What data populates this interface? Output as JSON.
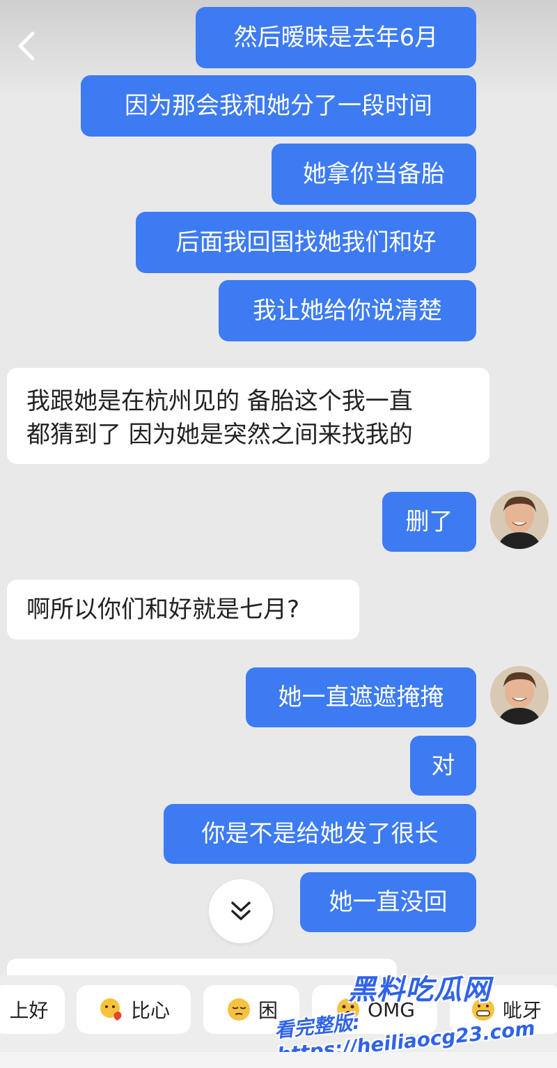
{
  "header": {
    "back_icon": "chevron-left-icon"
  },
  "messages": [
    {
      "side": "out",
      "text": "然后暧昧是去年6月"
    },
    {
      "side": "out",
      "text": "因为那会我和她分了一段时间"
    },
    {
      "side": "out",
      "text": "她拿你当备胎"
    },
    {
      "side": "out",
      "text": "后面我回国找她我们和好"
    },
    {
      "side": "out",
      "text": "我让她给你说清楚"
    },
    {
      "side": "in",
      "lines": [
        "我跟她是在杭州见的 备胎这个我一直",
        "都猜到了 因为她是突然之间来找我的"
      ]
    },
    {
      "side": "out",
      "text": "删了"
    },
    {
      "side": "in",
      "text": "啊所以你们和好就是七月?"
    },
    {
      "side": "out",
      "text": "她一直遮遮掩掩"
    },
    {
      "side": "out",
      "text": "对"
    },
    {
      "side": "out",
      "text": "你是不是给她发了很长"
    },
    {
      "side": "out",
      "text": "她一直没回"
    }
  ],
  "scroll_button_icon": "double-chevron-down-icon",
  "quick_replies": [
    {
      "label": "上好",
      "icon": ""
    },
    {
      "label": "比心",
      "icon": "heart-hands-emoji"
    },
    {
      "label": "困",
      "icon": "sleepy-emoji"
    },
    {
      "label": "OMG",
      "icon": "omg-emoji"
    },
    {
      "label": "呲牙",
      "icon": "grin-emoji"
    }
  ],
  "watermark": {
    "brand": "黑料吃瓜网",
    "line": "看完整版: https://heiliaocg23.com"
  },
  "colors": {
    "outgoing": "#3d7bf2",
    "incoming": "#ffffff",
    "background": "#e9e9e9"
  }
}
